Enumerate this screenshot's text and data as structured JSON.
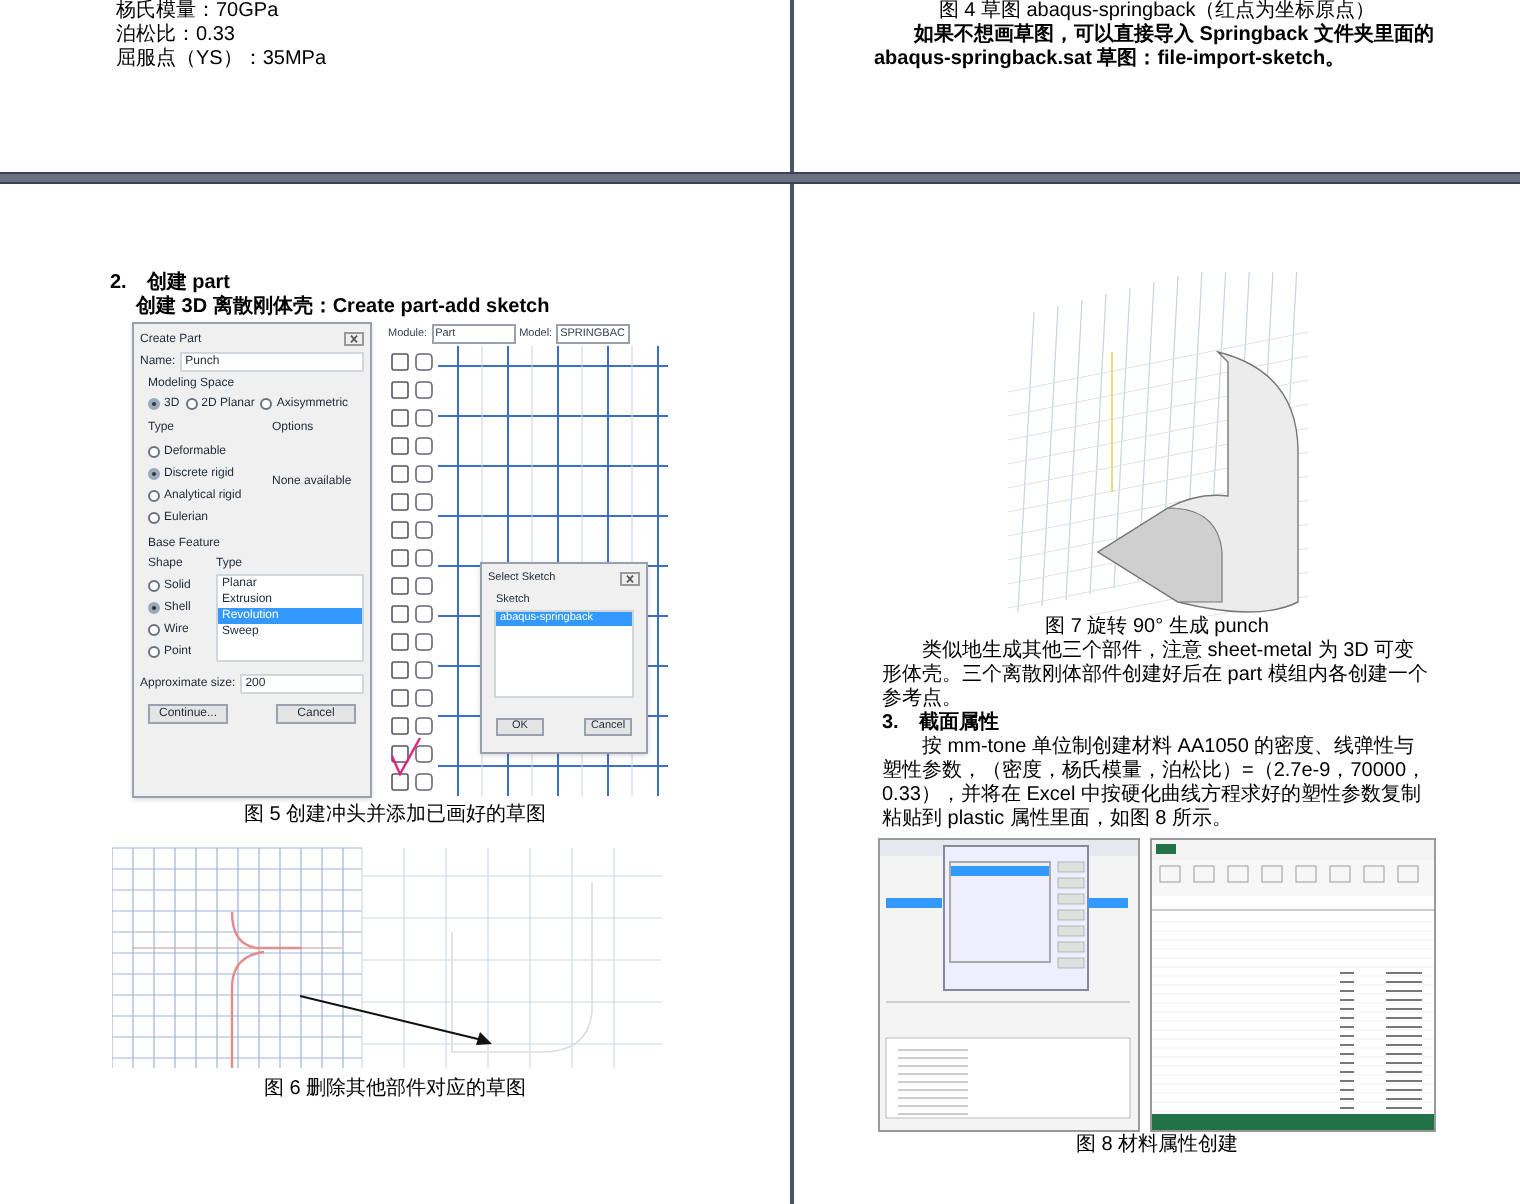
{
  "top_left_page": {
    "lines": [
      "杨氏模量：70GPa",
      "泊松比：0.33",
      "屈服点（YS）：35MPa"
    ]
  },
  "top_right_page": {
    "caption": "图 4 草图 abaqus-springback（红点为坐标原点）",
    "paragraph": "如果不想画草图，可以直接导入 Springback 文件夹里面的 abaqus-springback.sat 草图：file-import-sketch。"
  },
  "bottom_left_page": {
    "heading_number": "2.",
    "heading": "创建 part",
    "intro": "创建 3D 离散刚体壳：Create part-add sketch",
    "create_part_dialog": {
      "title": "Create Part",
      "name_label": "Name:",
      "name_value": "Punch",
      "modeling_space_label": "Modeling Space",
      "modeling_space": [
        {
          "label": "3D",
          "selected": true
        },
        {
          "label": "2D Planar",
          "selected": false
        },
        {
          "label": "Axisymmetric",
          "selected": false
        }
      ],
      "type_label": "Type",
      "options_label": "Options",
      "options_text": "None available",
      "types": [
        {
          "label": "Deformable",
          "selected": false
        },
        {
          "label": "Discrete rigid",
          "selected": true
        },
        {
          "label": "Analytical rigid",
          "selected": false
        },
        {
          "label": "Eulerian",
          "selected": false
        }
      ],
      "base_feature_label": "Base Feature",
      "shape_label": "Shape",
      "feature_type_label": "Type",
      "shapes": [
        {
          "label": "Solid",
          "selected": false
        },
        {
          "label": "Shell",
          "selected": true
        },
        {
          "label": "Wire",
          "selected": false
        },
        {
          "label": "Point",
          "selected": false
        }
      ],
      "feature_types": [
        {
          "label": "Planar",
          "selected": false
        },
        {
          "label": "Extrusion",
          "selected": false
        },
        {
          "label": "Revolution",
          "selected": true
        },
        {
          "label": "Sweep",
          "selected": false
        }
      ],
      "size_label": "Approximate size:",
      "size_value": "200",
      "buttons": [
        "Continue...",
        "Cancel"
      ]
    },
    "viewport": {
      "module_label": "Module:",
      "module_value": "Part",
      "model_label": "Model:",
      "model_value": "SPRINGBAC"
    },
    "select_sketch_dialog": {
      "title": "Select Sketch",
      "list_label": "Sketch",
      "items": [
        {
          "label": "abaqus-springback",
          "selected": true
        }
      ],
      "buttons": [
        "OK",
        "Cancel"
      ]
    },
    "fig5_caption": "图 5 创建冲头并添加已画好的草图",
    "fig6_caption": "图 6 删除其他部件对应的草图"
  },
  "bottom_right_page": {
    "fig7_caption": "图 7 旋转 90° 生成 punch",
    "paragraph1": "类似地生成其他三个部件，注意 sheet-metal 为 3D 可变形体壳。三个离散刚体部件创建好后在 part 模组内各创建一个参考点。",
    "heading_number": "3.",
    "heading": "截面属性",
    "paragraph2": "按 mm-tone 单位制创建材料 AA1050 的密度、线弹性与塑性参数，（密度，杨氏模量，泊松比）=（2.7e-9，70000，0.33），并将在 Excel 中按硬化曲线方程求好的塑性参数复制粘贴到 plastic 属性里面，如图 8 所示。",
    "fig8_caption": "图 8 材料属性创建"
  }
}
